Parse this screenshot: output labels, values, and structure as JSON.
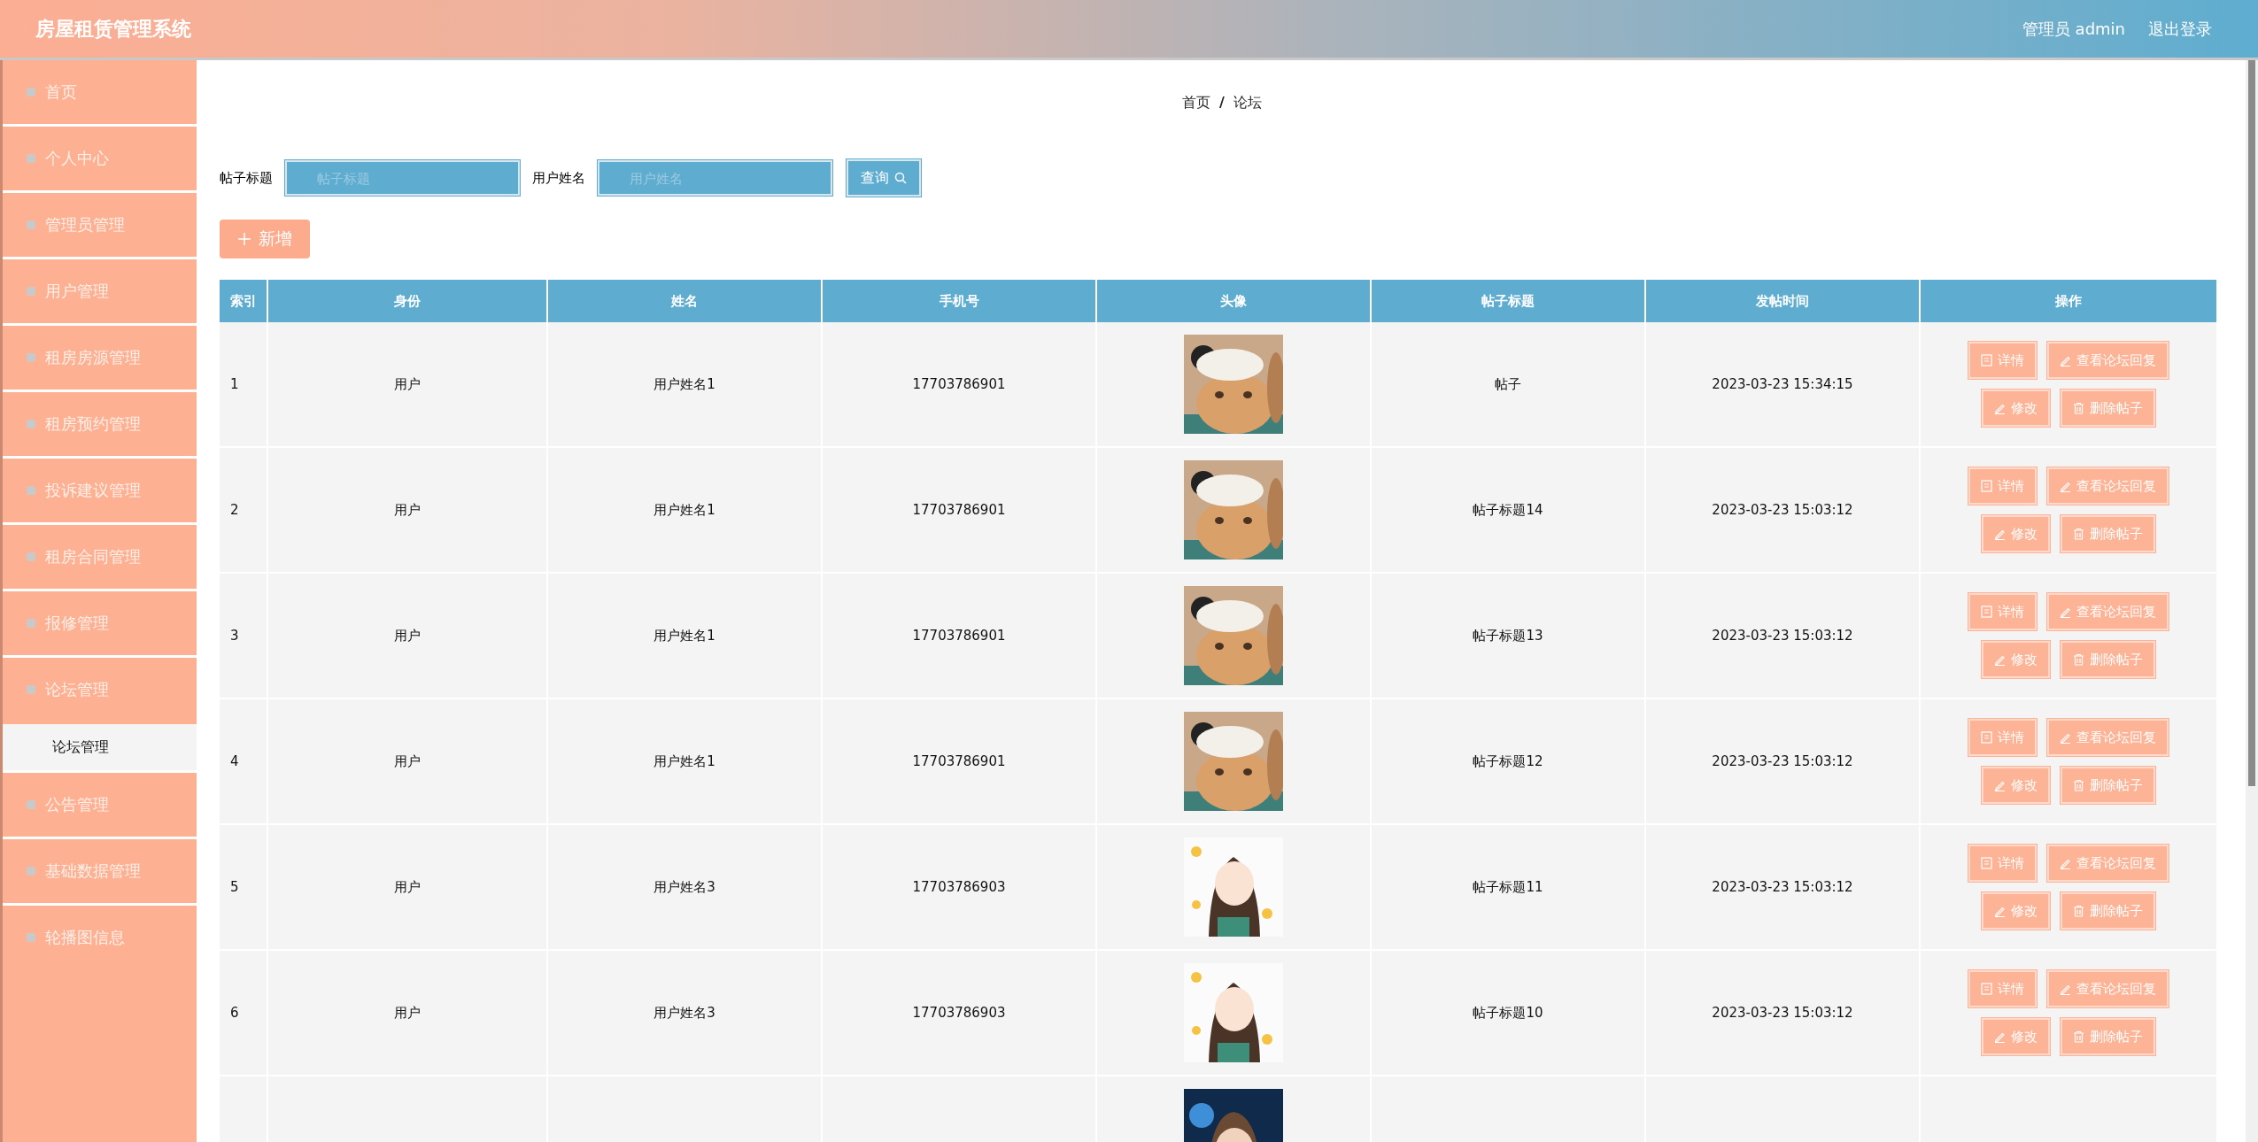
{
  "header": {
    "title": "房屋租赁管理系统",
    "user": "管理员 admin",
    "logout": "退出登录"
  },
  "sidebar": {
    "items": [
      {
        "label": "首页"
      },
      {
        "label": "个人中心"
      },
      {
        "label": "管理员管理"
      },
      {
        "label": "用户管理"
      },
      {
        "label": "租房房源管理"
      },
      {
        "label": "租房预约管理"
      },
      {
        "label": "投诉建议管理"
      },
      {
        "label": "租房合同管理"
      },
      {
        "label": "报修管理"
      },
      {
        "label": "论坛管理",
        "children": [
          {
            "label": "论坛管理",
            "selected": true
          }
        ]
      },
      {
        "label": "公告管理"
      },
      {
        "label": "基础数据管理"
      },
      {
        "label": "轮播图信息"
      }
    ]
  },
  "breadcrumb": {
    "home": "首页",
    "separator": "/",
    "current": "论坛"
  },
  "search": {
    "fields": [
      {
        "label": "帖子标题",
        "placeholder": "帖子标题"
      },
      {
        "label": "用户姓名",
        "placeholder": "用户姓名"
      }
    ],
    "button": "查询"
  },
  "add_button": "新增",
  "table": {
    "columns": [
      "索引",
      "身份",
      "姓名",
      "手机号",
      "头像",
      "帖子标题",
      "发帖时间",
      "操作"
    ],
    "rows": [
      {
        "index": "1",
        "role": "用户",
        "name": "用户姓名1",
        "phone": "17703786901",
        "avatar": {
          "kind": "picture"
        },
        "title": "帖子",
        "time": "2023-03-23 15:34:15",
        "actions": [
          {
            "kind": "detail",
            "label": "详情"
          },
          {
            "kind": "reply",
            "label": "查看论坛回复"
          },
          {
            "kind": "edit",
            "label": "修改"
          },
          {
            "kind": "delete",
            "label": "删除帖子"
          }
        ]
      },
      {
        "index": "2",
        "role": "用户",
        "name": "用户姓名1",
        "phone": "17703786901",
        "avatar": {
          "kind": "picture"
        },
        "title": "帖子标题14",
        "time": "2023-03-23 15:03:12",
        "actions": [
          {
            "kind": "detail",
            "label": "详情"
          },
          {
            "kind": "reply",
            "label": "查看论坛回复"
          },
          {
            "kind": "edit",
            "label": "修改"
          },
          {
            "kind": "delete",
            "label": "删除帖子"
          }
        ]
      },
      {
        "index": "3",
        "role": "用户",
        "name": "用户姓名1",
        "phone": "17703786901",
        "avatar": {
          "kind": "picture"
        },
        "title": "帖子标题13",
        "time": "2023-03-23 15:03:12",
        "actions": [
          {
            "kind": "detail",
            "label": "详情"
          },
          {
            "kind": "reply",
            "label": "查看论坛回复"
          },
          {
            "kind": "edit",
            "label": "修改"
          },
          {
            "kind": "delete",
            "label": "删除帖子"
          }
        ]
      },
      {
        "index": "4",
        "role": "用户",
        "name": "用户姓名1",
        "phone": "17703786901",
        "avatar": {
          "kind": "picture"
        },
        "title": "帖子标题12",
        "time": "2023-03-23 15:03:12",
        "actions": [
          {
            "kind": "detail",
            "label": "详情"
          },
          {
            "kind": "reply",
            "label": "查看论坛回复"
          },
          {
            "kind": "edit",
            "label": "修改"
          },
          {
            "kind": "delete",
            "label": "删除帖子"
          }
        ]
      },
      {
        "index": "5",
        "role": "用户",
        "name": "用户姓名3",
        "phone": "17703786903",
        "avatar": {
          "kind": "picture"
        },
        "title": "帖子标题11",
        "time": "2023-03-23 15:03:12",
        "actions": [
          {
            "kind": "detail",
            "label": "详情"
          },
          {
            "kind": "reply",
            "label": "查看论坛回复"
          },
          {
            "kind": "edit",
            "label": "修改"
          },
          {
            "kind": "delete",
            "label": "删除帖子"
          }
        ]
      },
      {
        "index": "6",
        "role": "用户",
        "name": "用户姓名3",
        "phone": "17703786903",
        "avatar": {
          "kind": "picture"
        },
        "title": "帖子标题10",
        "time": "2023-03-23 15:03:12",
        "actions": [
          {
            "kind": "detail",
            "label": "详情"
          },
          {
            "kind": "reply",
            "label": "查看论坛回复"
          },
          {
            "kind": "edit",
            "label": "修改"
          },
          {
            "kind": "delete",
            "label": "删除帖子"
          }
        ]
      },
      {
        "avatar": {
          "kind": "picture"
        }
      }
    ]
  }
}
